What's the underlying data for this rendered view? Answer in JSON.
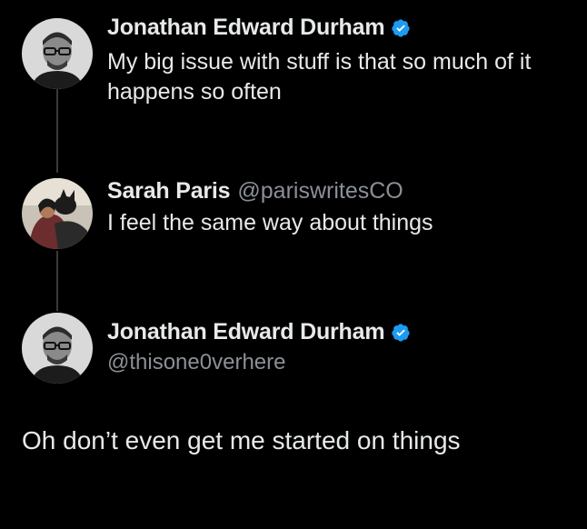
{
  "colors": {
    "background": "#000000",
    "text_primary": "#e7e9ea",
    "text_secondary": "#8b9096",
    "verified_blue": "#1d9bf0",
    "thread_line": "#3a3a3a"
  },
  "thread": [
    {
      "name": "Jonathan Edward Durham",
      "verified": true,
      "text": "My big issue with stuff is that so much of it happens so often",
      "avatar_icon": "avatar-man-glasses"
    },
    {
      "name": "Sarah Paris",
      "handle": "@pariswritesCO",
      "verified": false,
      "text": "I feel the same way about things",
      "avatar_icon": "avatar-woman-with-dog"
    }
  ],
  "main_tweet": {
    "name": "Jonathan Edward Durham",
    "handle": "@thisone0verhere",
    "verified": true,
    "text": "Oh don’t even get me started on things",
    "avatar_icon": "avatar-man-glasses"
  }
}
